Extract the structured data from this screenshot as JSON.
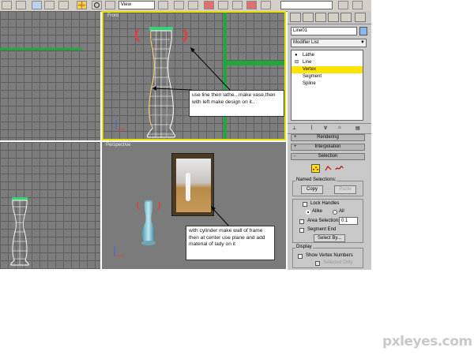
{
  "toolbar": {
    "view_label": "View"
  },
  "viewports": {
    "front_label": "Front",
    "perspective_label": "Perspective"
  },
  "command_panel": {
    "object_name": "Line01",
    "modifier_list": "Modifier List",
    "stack": [
      {
        "label": "Lathe",
        "selected": false
      },
      {
        "label": "Line",
        "selected": false
      },
      {
        "label": "Vertex",
        "selected": true
      },
      {
        "label": "Segment",
        "selected": false
      },
      {
        "label": "Spline",
        "selected": false
      }
    ],
    "rollouts": {
      "rendering": "Rendering",
      "interpolation": "Interpolation",
      "selection": "Selection"
    },
    "named_selections": {
      "title": "Named Selections:",
      "copy": "Copy",
      "paste": "Paste"
    },
    "lock_handles": {
      "label": "Lock Handles",
      "alike": "Alike",
      "all": "All"
    },
    "area_selection": {
      "label": "Area Selection:",
      "value": "0.1"
    },
    "segment_end": "Segment End",
    "select_by": "Select By...",
    "display": {
      "title": "Display",
      "show_vertex_numbers": "Show Vertex Numbers",
      "selected_only": "Selected Only"
    },
    "colors": {
      "selected_stack": "#ffe400",
      "viewport_border": "#e8e000"
    }
  },
  "annotations": {
    "front_note": "use line then lathe...make vase,then with left make design on it..",
    "persp_note": "with cylinder make wall of frame then at center use plane and add material of lady on it"
  },
  "watermark": "pxleyes.com"
}
